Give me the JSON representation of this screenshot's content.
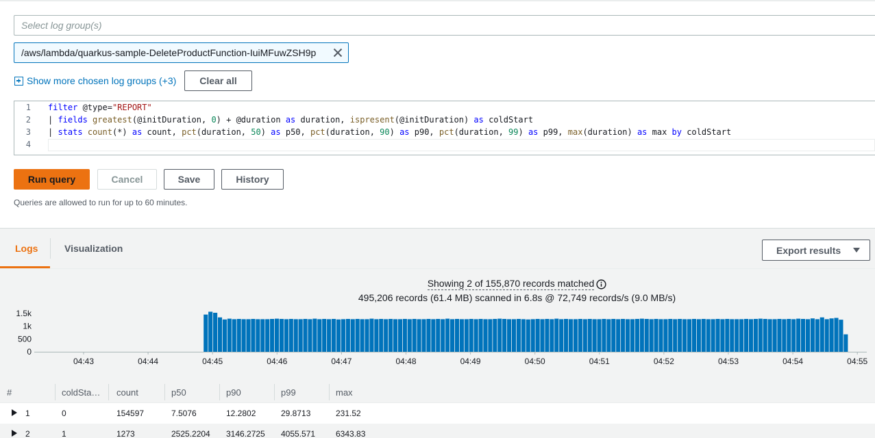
{
  "log_groups": {
    "placeholder": "Select log group(s)",
    "selected": "/aws/lambda/quarkus-sample-DeleteProductFunction-IuiMFuwZSH9p",
    "show_more_label": "Show more chosen log groups (+3)",
    "clear_all_label": "Clear all"
  },
  "editor": {
    "line_numbers": [
      "1",
      "2",
      "3",
      "4"
    ],
    "lines": [
      "filter @type=\"REPORT\"",
      "| fields greatest(@initDuration, 0) + @duration as duration, ispresent(@initDuration) as coldStart",
      "| stats count(*) as count, pct(duration, 50) as p50, pct(duration, 90) as p90, pct(duration, 99) as p99, max(duration) as max by coldStart",
      ""
    ]
  },
  "actions": {
    "run": "Run query",
    "cancel": "Cancel",
    "save": "Save",
    "history": "History",
    "note": "Queries are allowed to run for up to 60 minutes."
  },
  "results": {
    "tabs": [
      "Logs",
      "Visualization"
    ],
    "active_tab": "Logs",
    "export_label": "Export results",
    "summary_matched": "Showing 2 of 155,870 records matched",
    "summary_scanned": "495,206 records (61.4 MB) scanned in 6.8s @ 72,749 records/s (9.0 MB/s)"
  },
  "colors": {
    "accent": "#ec7211",
    "link": "#0073bb",
    "bar": "#0073bb"
  },
  "chart_data": {
    "type": "bar",
    "x_tick_labels": [
      "04:43",
      "04:44",
      "04:45",
      "04:46",
      "04:47",
      "04:48",
      "04:49",
      "04:50",
      "04:51",
      "04:52",
      "04:53",
      "04:54",
      "04:55"
    ],
    "y_tick_labels": [
      "1.5k",
      "1k",
      "500",
      "0"
    ],
    "ylim": [
      0,
      1600
    ],
    "bar_start_label": "04:45",
    "values": [
      1450,
      1560,
      1520,
      1340,
      1260,
      1290,
      1270,
      1280,
      1270,
      1270,
      1280,
      1270,
      1270,
      1270,
      1280,
      1290,
      1280,
      1270,
      1280,
      1270,
      1270,
      1280,
      1270,
      1290,
      1270,
      1280,
      1270,
      1280,
      1260,
      1270,
      1280,
      1270,
      1280,
      1270,
      1270,
      1290,
      1270,
      1280,
      1270,
      1280,
      1270,
      1270,
      1280,
      1270,
      1280,
      1270,
      1270,
      1280,
      1270,
      1280,
      1270,
      1290,
      1270,
      1280,
      1270,
      1270,
      1280,
      1270,
      1280,
      1270,
      1270,
      1280,
      1290,
      1280,
      1270,
      1270,
      1280,
      1270,
      1260,
      1270,
      1280,
      1270,
      1280,
      1270,
      1290,
      1270,
      1280,
      1270,
      1270,
      1280,
      1270,
      1280,
      1270,
      1270,
      1280,
      1270,
      1280,
      1270,
      1280,
      1270,
      1270,
      1280,
      1290,
      1280,
      1270,
      1280,
      1270,
      1270,
      1280,
      1270,
      1280,
      1270,
      1270,
      1280,
      1270,
      1280,
      1270,
      1270,
      1280,
      1270,
      1280,
      1270,
      1270,
      1270,
      1280,
      1270,
      1280,
      1290,
      1280,
      1270,
      1270,
      1280,
      1270,
      1280,
      1270,
      1290,
      1280,
      1270,
      1300,
      1270,
      1340,
      1270,
      1300,
      1320,
      1250,
      680
    ]
  },
  "table": {
    "columns": [
      "#",
      "coldSta…",
      "count",
      "p50",
      "p90",
      "p99",
      "max"
    ],
    "rows": [
      [
        "1",
        "0",
        "154597",
        "7.5076",
        "12.2802",
        "29.8713",
        "231.52"
      ],
      [
        "2",
        "1",
        "1273",
        "2525.2204",
        "3146.2725",
        "4055.571",
        "6343.83"
      ]
    ]
  }
}
